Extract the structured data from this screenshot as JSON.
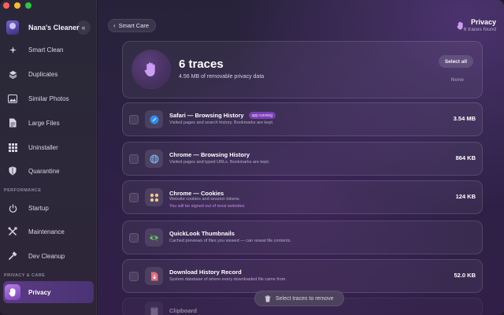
{
  "app": {
    "name": "Nana's Cleaner"
  },
  "sidebar": {
    "collapse_icon": "double-chevron-left-icon",
    "items": [
      {
        "label": "Smart Clean",
        "icon": "sparkles-icon"
      },
      {
        "label": "Duplicates",
        "icon": "layers-icon"
      },
      {
        "label": "Similar Photos",
        "icon": "photo-icon"
      },
      {
        "label": "Large Files",
        "icon": "document-icon"
      },
      {
        "label": "Uninstaller",
        "icon": "grid-icon"
      },
      {
        "label": "Quarantine",
        "icon": "shield-icon"
      }
    ],
    "section_performance": "PERFORMANCE",
    "performance_items": [
      {
        "label": "Startup",
        "icon": "power-icon"
      },
      {
        "label": "Maintenance",
        "icon": "tools-icon"
      },
      {
        "label": "Dev Cleanup",
        "icon": "hammer-icon"
      }
    ],
    "section_privacy": "PRIVACY & CARE",
    "privacy_items": [
      {
        "label": "Privacy",
        "icon": "hand-icon",
        "active": true
      }
    ]
  },
  "header": {
    "back_label": "Smart Care",
    "title": "Privacy",
    "subtitle": "6 traces found"
  },
  "summary": {
    "title": "6 traces",
    "subtitle": "4.56 MB of removable privacy data",
    "select_all": "Select all",
    "none": "None"
  },
  "traces": [
    {
      "title": "Safari — Browsing History",
      "badge": "app running",
      "description": "Visited pages and search history. Bookmarks are kept.",
      "size": "3.54 MB",
      "icon": "compass-icon"
    },
    {
      "title": "Chrome — Browsing History",
      "description": "Visited pages and typed URLs. Bookmarks are kept.",
      "size": "864 KB",
      "icon": "globe-icon"
    },
    {
      "title": "Chrome — Cookies",
      "description": "Website cookies and session tokens.",
      "warning": "You will be signed out of most websites",
      "size": "124 KB",
      "icon": "cookies-icon"
    },
    {
      "title": "QuickLook Thumbnails",
      "description": "Cached previews of files you viewed — can reveal file contents.",
      "size": "",
      "icon": "eye-slash-icon"
    },
    {
      "title": "Download History Record",
      "description": "System database of where every downloaded file came from.",
      "size": "52.0 KB",
      "icon": "download-file-icon"
    },
    {
      "title": "Clipboard",
      "description": "",
      "size": "",
      "icon": "clipboard-icon"
    }
  ],
  "footer": {
    "action_label": "Select traces to remove"
  }
}
